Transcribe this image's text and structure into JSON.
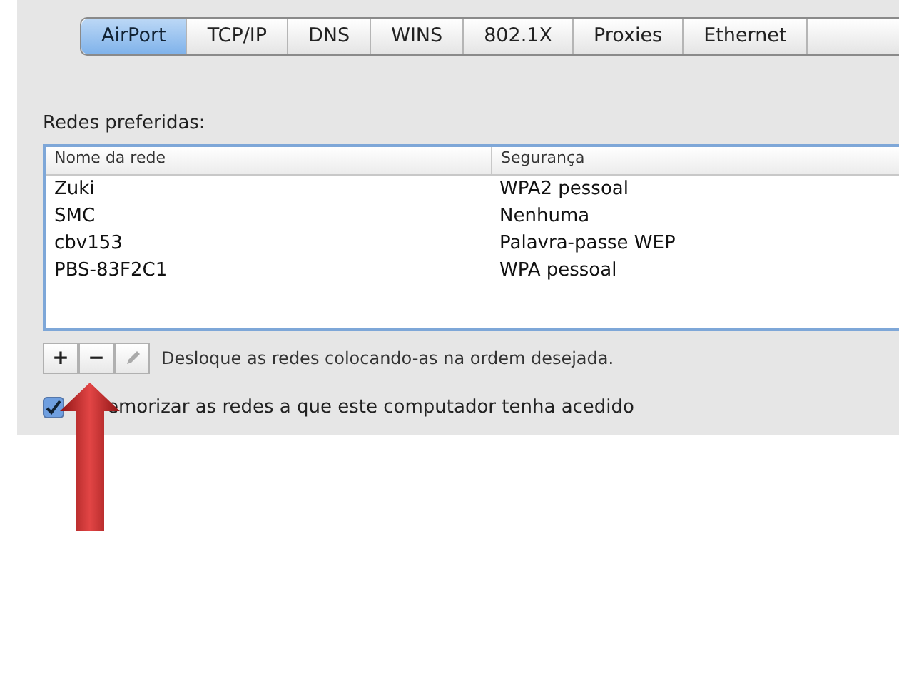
{
  "tabs": [
    {
      "label": "AirPort",
      "selected": true
    },
    {
      "label": "TCP/IP",
      "selected": false
    },
    {
      "label": "DNS",
      "selected": false
    },
    {
      "label": "WINS",
      "selected": false
    },
    {
      "label": "802.1X",
      "selected": false
    },
    {
      "label": "Proxies",
      "selected": false
    },
    {
      "label": "Ethernet",
      "selected": false
    }
  ],
  "section_label": "Redes preferidas:",
  "table": {
    "columns": [
      "Nome da rede",
      "Segurança"
    ],
    "rows": [
      [
        "Zuki",
        "WPA2 pessoal"
      ],
      [
        "SMC",
        "Nenhuma"
      ],
      [
        "cbv153",
        "Palavra-passe WEP"
      ],
      [
        "PBS-83F2C1",
        "WPA pessoal"
      ]
    ]
  },
  "buttons": [
    {
      "kind": "text",
      "label": "+"
    },
    {
      "kind": "text",
      "label": "−"
    },
    {
      "kind": "pencil"
    }
  ],
  "hint": "Desloque as redes colocando-as na ordem desejada.",
  "checkbox": {
    "label": "emorizar as redes a que este computador tenha acedido",
    "checked": true
  }
}
